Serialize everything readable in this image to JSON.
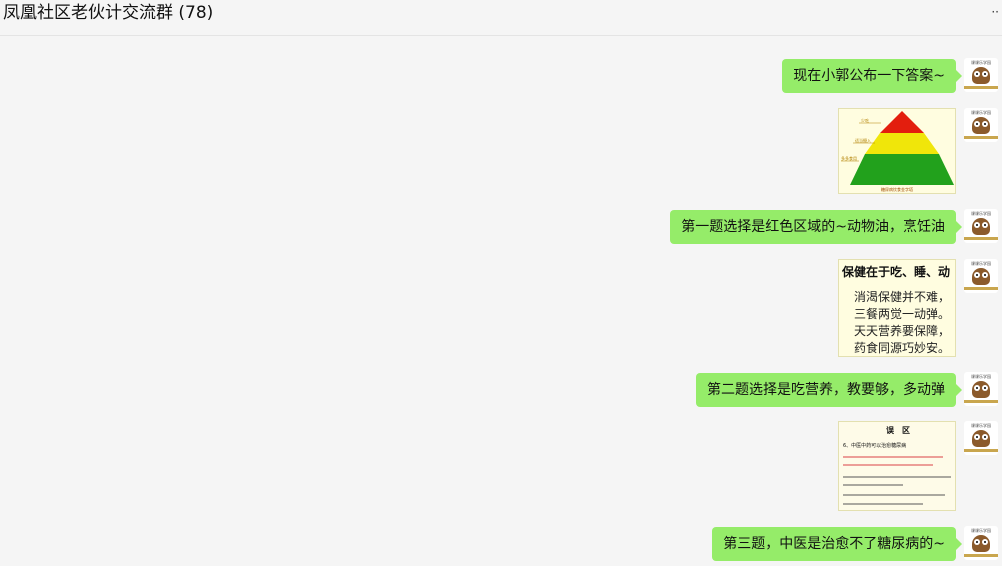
{
  "window": {
    "title": "凤凰社区老伙计交流群 (78)",
    "more_icon": "more-dots-icon"
  },
  "avatar": {
    "caption": "课课乐学园",
    "icon": "owl-avatar-icon"
  },
  "messages": [
    {
      "type": "text",
      "text": "现在小郭公布一下答案~"
    },
    {
      "type": "image",
      "image": {
        "kind": "food-pyramid",
        "labels": [
          "少吃",
          "适当摄入",
          "多多食用",
          "糖尿病饮食金字塔"
        ],
        "colors": {
          "top": "#e31e0e",
          "middle": "#f0e60a",
          "bottom": "#22a11c"
        }
      }
    },
    {
      "type": "text",
      "text": "第一题选择是红色区域的~动物油，烹饪油"
    },
    {
      "type": "image",
      "image": {
        "kind": "health-card",
        "title": "保健在于吃、睡、动",
        "lines": [
          "消渴保健并不难，",
          "三餐两觉一动弹。",
          "天天营养要保障，",
          "药食同源巧妙安。"
        ]
      }
    },
    {
      "type": "text",
      "text": "第二题选择是吃营养，教要够，多动弹"
    },
    {
      "type": "image",
      "image": {
        "kind": "slide",
        "title": "误　区",
        "lines": [
          "6、中医中药可以治愈糖尿病"
        ]
      }
    },
    {
      "type": "text",
      "text": "第三题，中医是治愈不了糖尿病的~"
    }
  ]
}
